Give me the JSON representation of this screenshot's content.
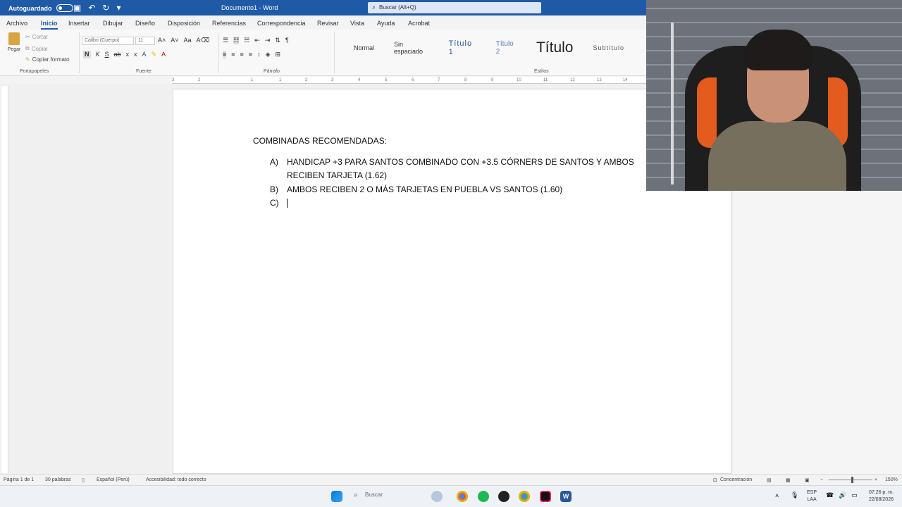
{
  "titlebar": {
    "autosave_label": "Autoguardado",
    "document_title": "Documento1 - Word",
    "search_placeholder": "Buscar (Alt+Q)"
  },
  "tabs": [
    "Archivo",
    "Inicio",
    "Insertar",
    "Dibujar",
    "Diseño",
    "Disposición",
    "Referencias",
    "Correspondencia",
    "Revisar",
    "Vista",
    "Ayuda",
    "Acrobat"
  ],
  "ribbon": {
    "paste_label": "Pegar",
    "cut_label": "Cortar",
    "copy_label": "Copiar",
    "format_painter_label": "Copiar formato",
    "clipboard_group": "Portapapeles",
    "font_name": "Calibri (Cuerpo)",
    "font_size": "11",
    "font_group": "Fuente",
    "paragraph_group": "Párrafo",
    "styles_group": "Estilos",
    "bold": "N",
    "italic": "K",
    "underline": "S",
    "strike": "ab",
    "subscript": "x",
    "superscript": "x",
    "styles": [
      "Normal",
      "Sin espaciado",
      "Título 1",
      "Título 2",
      "Título",
      "Subtítulo"
    ]
  },
  "ruler": {
    "ticks": [
      "3",
      "2",
      "1",
      "1",
      "2",
      "3",
      "4",
      "5",
      "6",
      "7",
      "8",
      "9",
      "10",
      "11",
      "12",
      "13",
      "14"
    ]
  },
  "document": {
    "heading": "COMBINADAS RECOMENDADAS:",
    "items": [
      {
        "marker": "A)",
        "line1": "HANDICAP +3 PARA SANTOS COMBINADO CON +3.5 CÓRNERS DE SANTOS Y AMBOS",
        "line2": "RECIBEN TARJETA (1.62)"
      },
      {
        "marker": "B)",
        "line1": "AMBOS RECIBEN 2 O MÁS TARJETAS EN PUEBLA VS SANTOS (1.60)",
        "line2": ""
      },
      {
        "marker": "C)",
        "line1": "",
        "line2": ""
      }
    ]
  },
  "statusbar": {
    "page": "Página 1 de 1",
    "words": "30 palabras",
    "language": "Español (Perú)",
    "accessibility": "Accesibilidad: todo correcto",
    "focus": "Concentración",
    "zoom": "150%"
  },
  "taskbar": {
    "search_label": "Buscar",
    "lang_top": "ESP",
    "lang_bottom": "LAA",
    "time": "07:26 p. m.",
    "date": "22/08/2026"
  },
  "colors": {
    "title_blue": "#1f5aa6",
    "chair_orange": "#e35b1e",
    "word_blue": "#2b579a"
  }
}
